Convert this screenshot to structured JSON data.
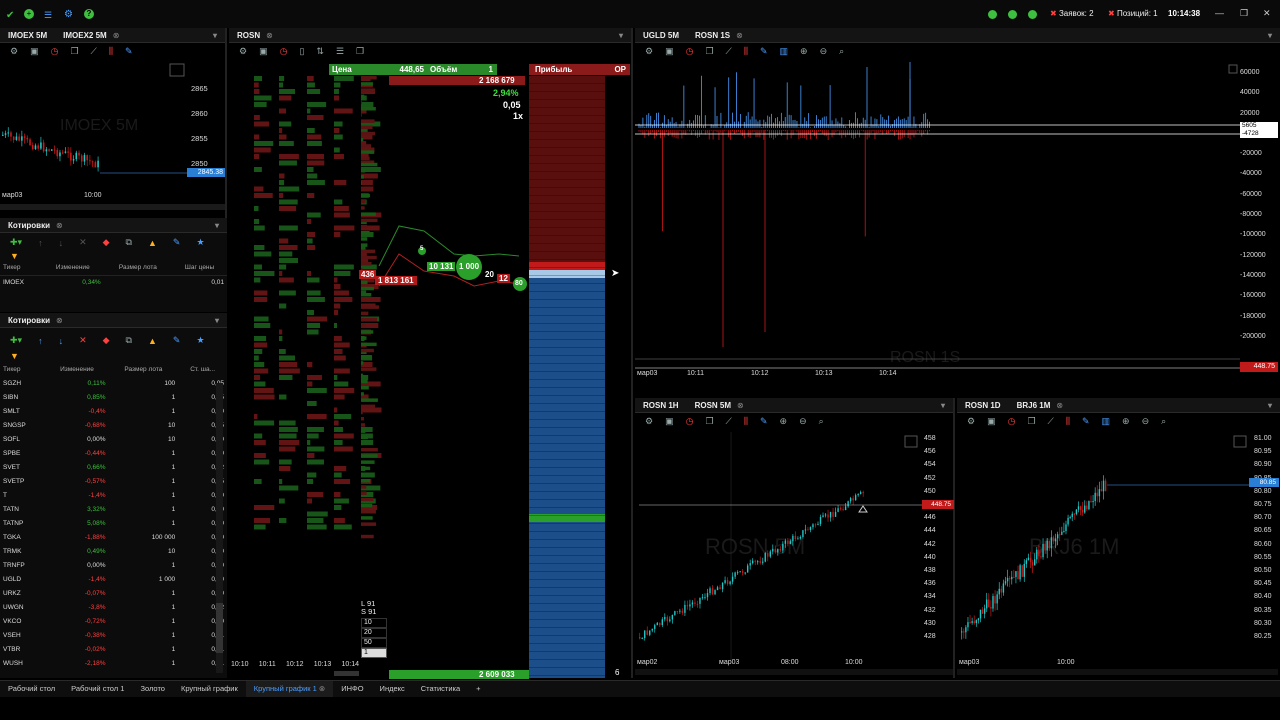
{
  "topbar": {
    "orders": "Заявок: 2",
    "positions": "Позиций: 1",
    "time": "10:14:38"
  },
  "panels": {
    "imoex": {
      "tabs": [
        "IMOEX 5M",
        "IMOEX2 5M"
      ],
      "ticks": [
        "2865",
        "2860",
        "2855",
        "2850"
      ],
      "price": "2845.38",
      "x": [
        "мар03",
        "10:00"
      ],
      "watermark": "IMOEX 5M"
    },
    "quotes1": {
      "title": "Котировки",
      "cols": [
        "Тикер",
        "Изменение",
        "Размер лота",
        "Шаг цены"
      ],
      "row": [
        "IMOEX",
        "0,34%",
        "",
        "0,01"
      ]
    },
    "quotes2": {
      "title": "Котировки",
      "cols": [
        "Тикер",
        "Изменение",
        "Размер лота",
        "Ст. ша..."
      ],
      "rows": [
        [
          "SGZH",
          "0,11%",
          "100",
          "0,05",
          "g"
        ],
        [
          "SIBN",
          "0,85%",
          "1",
          "0,05",
          "g"
        ],
        [
          "SMLT",
          "-0,4%",
          "1",
          "0,20",
          "r"
        ],
        [
          "SNGSP",
          "-0,68%",
          "10",
          "0,05",
          "r"
        ],
        [
          "SOFL",
          "0,00%",
          "10",
          "0,20",
          "n"
        ],
        [
          "SPBE",
          "-0,44%",
          "1",
          "0,10",
          "r"
        ],
        [
          "SVET",
          "0,66%",
          "1",
          "0,02",
          "g"
        ],
        [
          "SVETP",
          "-0,57%",
          "1",
          "0,05",
          "r"
        ],
        [
          "T",
          "-1,4%",
          "1",
          "0,20",
          "r"
        ],
        [
          "TATN",
          "3,32%",
          "1",
          "0,10",
          "g"
        ],
        [
          "TATNP",
          "5,08%",
          "1",
          "0,10",
          "g"
        ],
        [
          "TGKA",
          "-1,88%",
          "100 000",
          "0,20",
          "r"
        ],
        [
          "TRMK",
          "0,49%",
          "10",
          "0,10",
          "g"
        ],
        [
          "TRNFP",
          "0,00%",
          "1",
          "0,20",
          "n"
        ],
        [
          "UGLD",
          "-1,4%",
          "1 000",
          "0,10",
          "r"
        ],
        [
          "URKZ",
          "-0,07%",
          "1",
          "0,10",
          "r"
        ],
        [
          "UWGN",
          "-3,8%",
          "1",
          "0,02",
          "r"
        ],
        [
          "VKCO",
          "-0,72%",
          "1",
          "0,20",
          "r"
        ],
        [
          "VSEH",
          "-0,38%",
          "1",
          "0,01",
          "r"
        ],
        [
          "VTBR",
          "-0,02%",
          "1",
          "0,01",
          "r"
        ],
        [
          "WUSH",
          "-2,18%",
          "1",
          "0,01",
          "r"
        ]
      ]
    },
    "rosn": {
      "tab": "ROSN",
      "hdr": [
        "Цена",
        "448,65",
        "Объём",
        "1",
        "Прибыль",
        "OP"
      ],
      "stats": [
        "2 168 679",
        "2,94%",
        "0,05",
        "1x"
      ],
      "labels": [
        "436",
        "1 813 161",
        "5",
        "10 131",
        "1 000",
        "20",
        "12",
        "80"
      ],
      "bottom": [
        "L 91",
        "S 91"
      ],
      "qty": [
        "10",
        "20",
        "50",
        "1"
      ],
      "times": [
        "10:10",
        "10:11",
        "10:12",
        "10:13",
        "10:14"
      ],
      "total": "2 609 033",
      "six": "6"
    },
    "ugld": {
      "tabs": [
        "UGLD 5M",
        "ROSN 1S"
      ],
      "ticks": [
        "60000",
        "40000",
        "20000",
        "0",
        "-20000",
        "-40000",
        "-60000",
        "-80000",
        "-100000",
        "-120000",
        "-140000",
        "-160000",
        "-180000",
        "-200000"
      ],
      "marks": [
        "5605",
        "-4728"
      ],
      "price": "448.75",
      "x": [
        "мар03",
        "10:11",
        "10:12",
        "10:13",
        "10:14"
      ],
      "watermark": "ROSN 1S"
    },
    "rosn5": {
      "tabs": [
        "ROSN 1H",
        "ROSN 5M"
      ],
      "ticks": [
        "458",
        "456",
        "454",
        "452",
        "450",
        "448",
        "446",
        "444",
        "442",
        "440",
        "438",
        "436",
        "434",
        "432",
        "430",
        "428"
      ],
      "price": "448.75",
      "x": [
        "мар02",
        "мар03",
        "08:00",
        "10:00"
      ],
      "watermark": "ROSN 5M"
    },
    "brj": {
      "tabs": [
        "ROSN 1D",
        "BRJ6 1M"
      ],
      "ticks": [
        "81.00",
        "80.95",
        "80.90",
        "80.85",
        "80.80",
        "80.75",
        "80.70",
        "80.65",
        "80.60",
        "80.55",
        "80.50",
        "80.45",
        "80.40",
        "80.35",
        "80.30",
        "80.25"
      ],
      "price": "80.85",
      "x": [
        "мар03",
        "10:00"
      ],
      "watermark": "BRJ6 1M"
    }
  },
  "tabs": [
    "Рабочий стол",
    "Рабочий стол 1",
    "Золото",
    "Крупный график",
    "Крупный график 1",
    "ИНФО",
    "Индекс",
    "Статистика",
    "+"
  ]
}
